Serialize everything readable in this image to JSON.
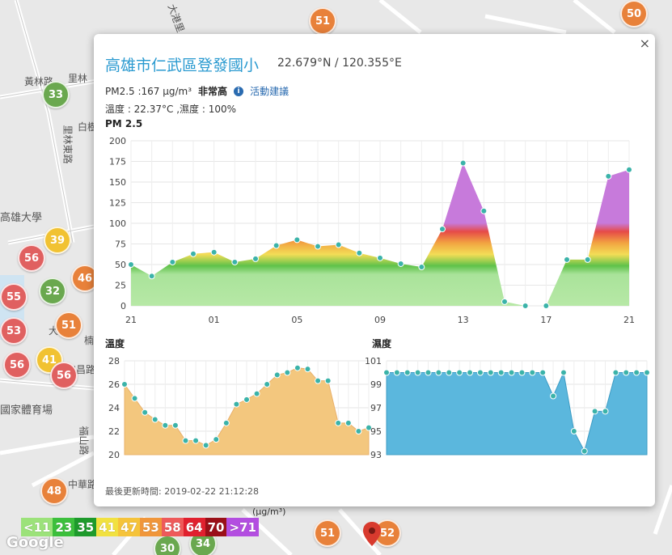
{
  "map": {
    "labels": [
      "大港里",
      "黃林路",
      "里林",
      "里林東路",
      "白樹",
      "高雄大學",
      "大衛路",
      "加昌路",
      "國家體育場",
      "福山路",
      "中華路",
      "楠"
    ],
    "markers": [
      {
        "value": "51",
        "color": "#e8813a"
      },
      {
        "value": "50",
        "color": "#e8813a"
      },
      {
        "value": "33",
        "color": "#6aa84f"
      },
      {
        "value": "39",
        "color": "#f1c232"
      },
      {
        "value": "56",
        "color": "#e06060"
      },
      {
        "value": "32",
        "color": "#6aa84f"
      },
      {
        "value": "46",
        "color": "#e8813a"
      },
      {
        "value": "55",
        "color": "#e06060"
      },
      {
        "value": "53",
        "color": "#e06060"
      },
      {
        "value": "51",
        "color": "#e8813a"
      },
      {
        "value": "41",
        "color": "#f1c232"
      },
      {
        "value": "56",
        "color": "#e06060"
      },
      {
        "value": "56",
        "color": "#e06060"
      },
      {
        "value": "48",
        "color": "#e8813a"
      },
      {
        "value": "51",
        "color": "#e8813a"
      },
      {
        "value": "30",
        "color": "#6aa84f"
      },
      {
        "value": "34",
        "color": "#6aa84f"
      },
      {
        "value": "52",
        "color": "#e8813a"
      }
    ],
    "google_label": "Google",
    "unit_fragment": "(μg/m³)"
  },
  "popup": {
    "title": "高雄市仁武區登發國小",
    "coords": "22.679°N / 120.355°E",
    "pm_text": "PM2.5 :167 μg/m³",
    "level": "非常高",
    "info_icon": "info-icon",
    "advice": "活動建議",
    "temp_humidity": "溫度 : 22.37°C ,濕度 : 100%",
    "close": "×",
    "updated": "最後更新時間: 2019-02-22 21:12:28"
  },
  "chart_data": [
    {
      "type": "area",
      "title": "PM 2.5",
      "x": [
        21,
        22,
        23,
        0,
        1,
        2,
        3,
        4,
        5,
        6,
        7,
        8,
        9,
        10,
        11,
        12,
        13,
        14,
        15,
        16,
        17,
        18,
        19,
        20,
        21
      ],
      "values": [
        50,
        36,
        53,
        63,
        65,
        53,
        57,
        73,
        80,
        72,
        74,
        64,
        58,
        51,
        47,
        93,
        173,
        115,
        5,
        0,
        0,
        56,
        56,
        157,
        165
      ],
      "xticks": [
        "21",
        "01",
        "05",
        "09",
        "13",
        "17",
        "21"
      ],
      "yticks": [
        0,
        25,
        50,
        75,
        100,
        125,
        150,
        175,
        200
      ],
      "ylim": [
        0,
        200
      ],
      "grid": true,
      "fill": "gradient by PM2.5 level (green, yellow, orange, red, purple)"
    },
    {
      "type": "area",
      "title": "溫度",
      "values": [
        26.0,
        24.8,
        23.6,
        23.0,
        22.5,
        22.5,
        21.2,
        21.2,
        20.8,
        21.3,
        22.7,
        24.3,
        24.7,
        25.2,
        26.0,
        26.8,
        27.0,
        27.4,
        27.3,
        26.3,
        26.3,
        22.7,
        22.7,
        22.0,
        22.3
      ],
      "yticks": [
        20,
        22,
        24,
        26,
        28
      ],
      "ylim": [
        20,
        28
      ],
      "grid": true,
      "color": "#f3c77e"
    },
    {
      "type": "area",
      "title": "濕度",
      "values": [
        100,
        100,
        100,
        100,
        100,
        100,
        100,
        100,
        100,
        100,
        100,
        100,
        100,
        100,
        100,
        100,
        98,
        100,
        95,
        93.3,
        96.7,
        96.7,
        100,
        100,
        100,
        100
      ],
      "yticks": [
        93,
        95,
        97,
        99,
        101
      ],
      "ylim": [
        93,
        101
      ],
      "grid": true,
      "color": "#5bb7dd"
    }
  ],
  "legend": [
    {
      "label": "<11",
      "color": "#9ce27a"
    },
    {
      "label": "23",
      "color": "#3cbf3c"
    },
    {
      "label": "35",
      "color": "#1e9a2c"
    },
    {
      "label": "41",
      "color": "#f1e140"
    },
    {
      "label": "47",
      "color": "#f5c33a"
    },
    {
      "label": "53",
      "color": "#f0963a"
    },
    {
      "label": "58",
      "color": "#ee5a5a"
    },
    {
      "label": "64",
      "color": "#e0202e"
    },
    {
      "label": "70",
      "color": "#9a1018"
    },
    {
      "label": ">71",
      "color": "#b34ee0"
    }
  ]
}
